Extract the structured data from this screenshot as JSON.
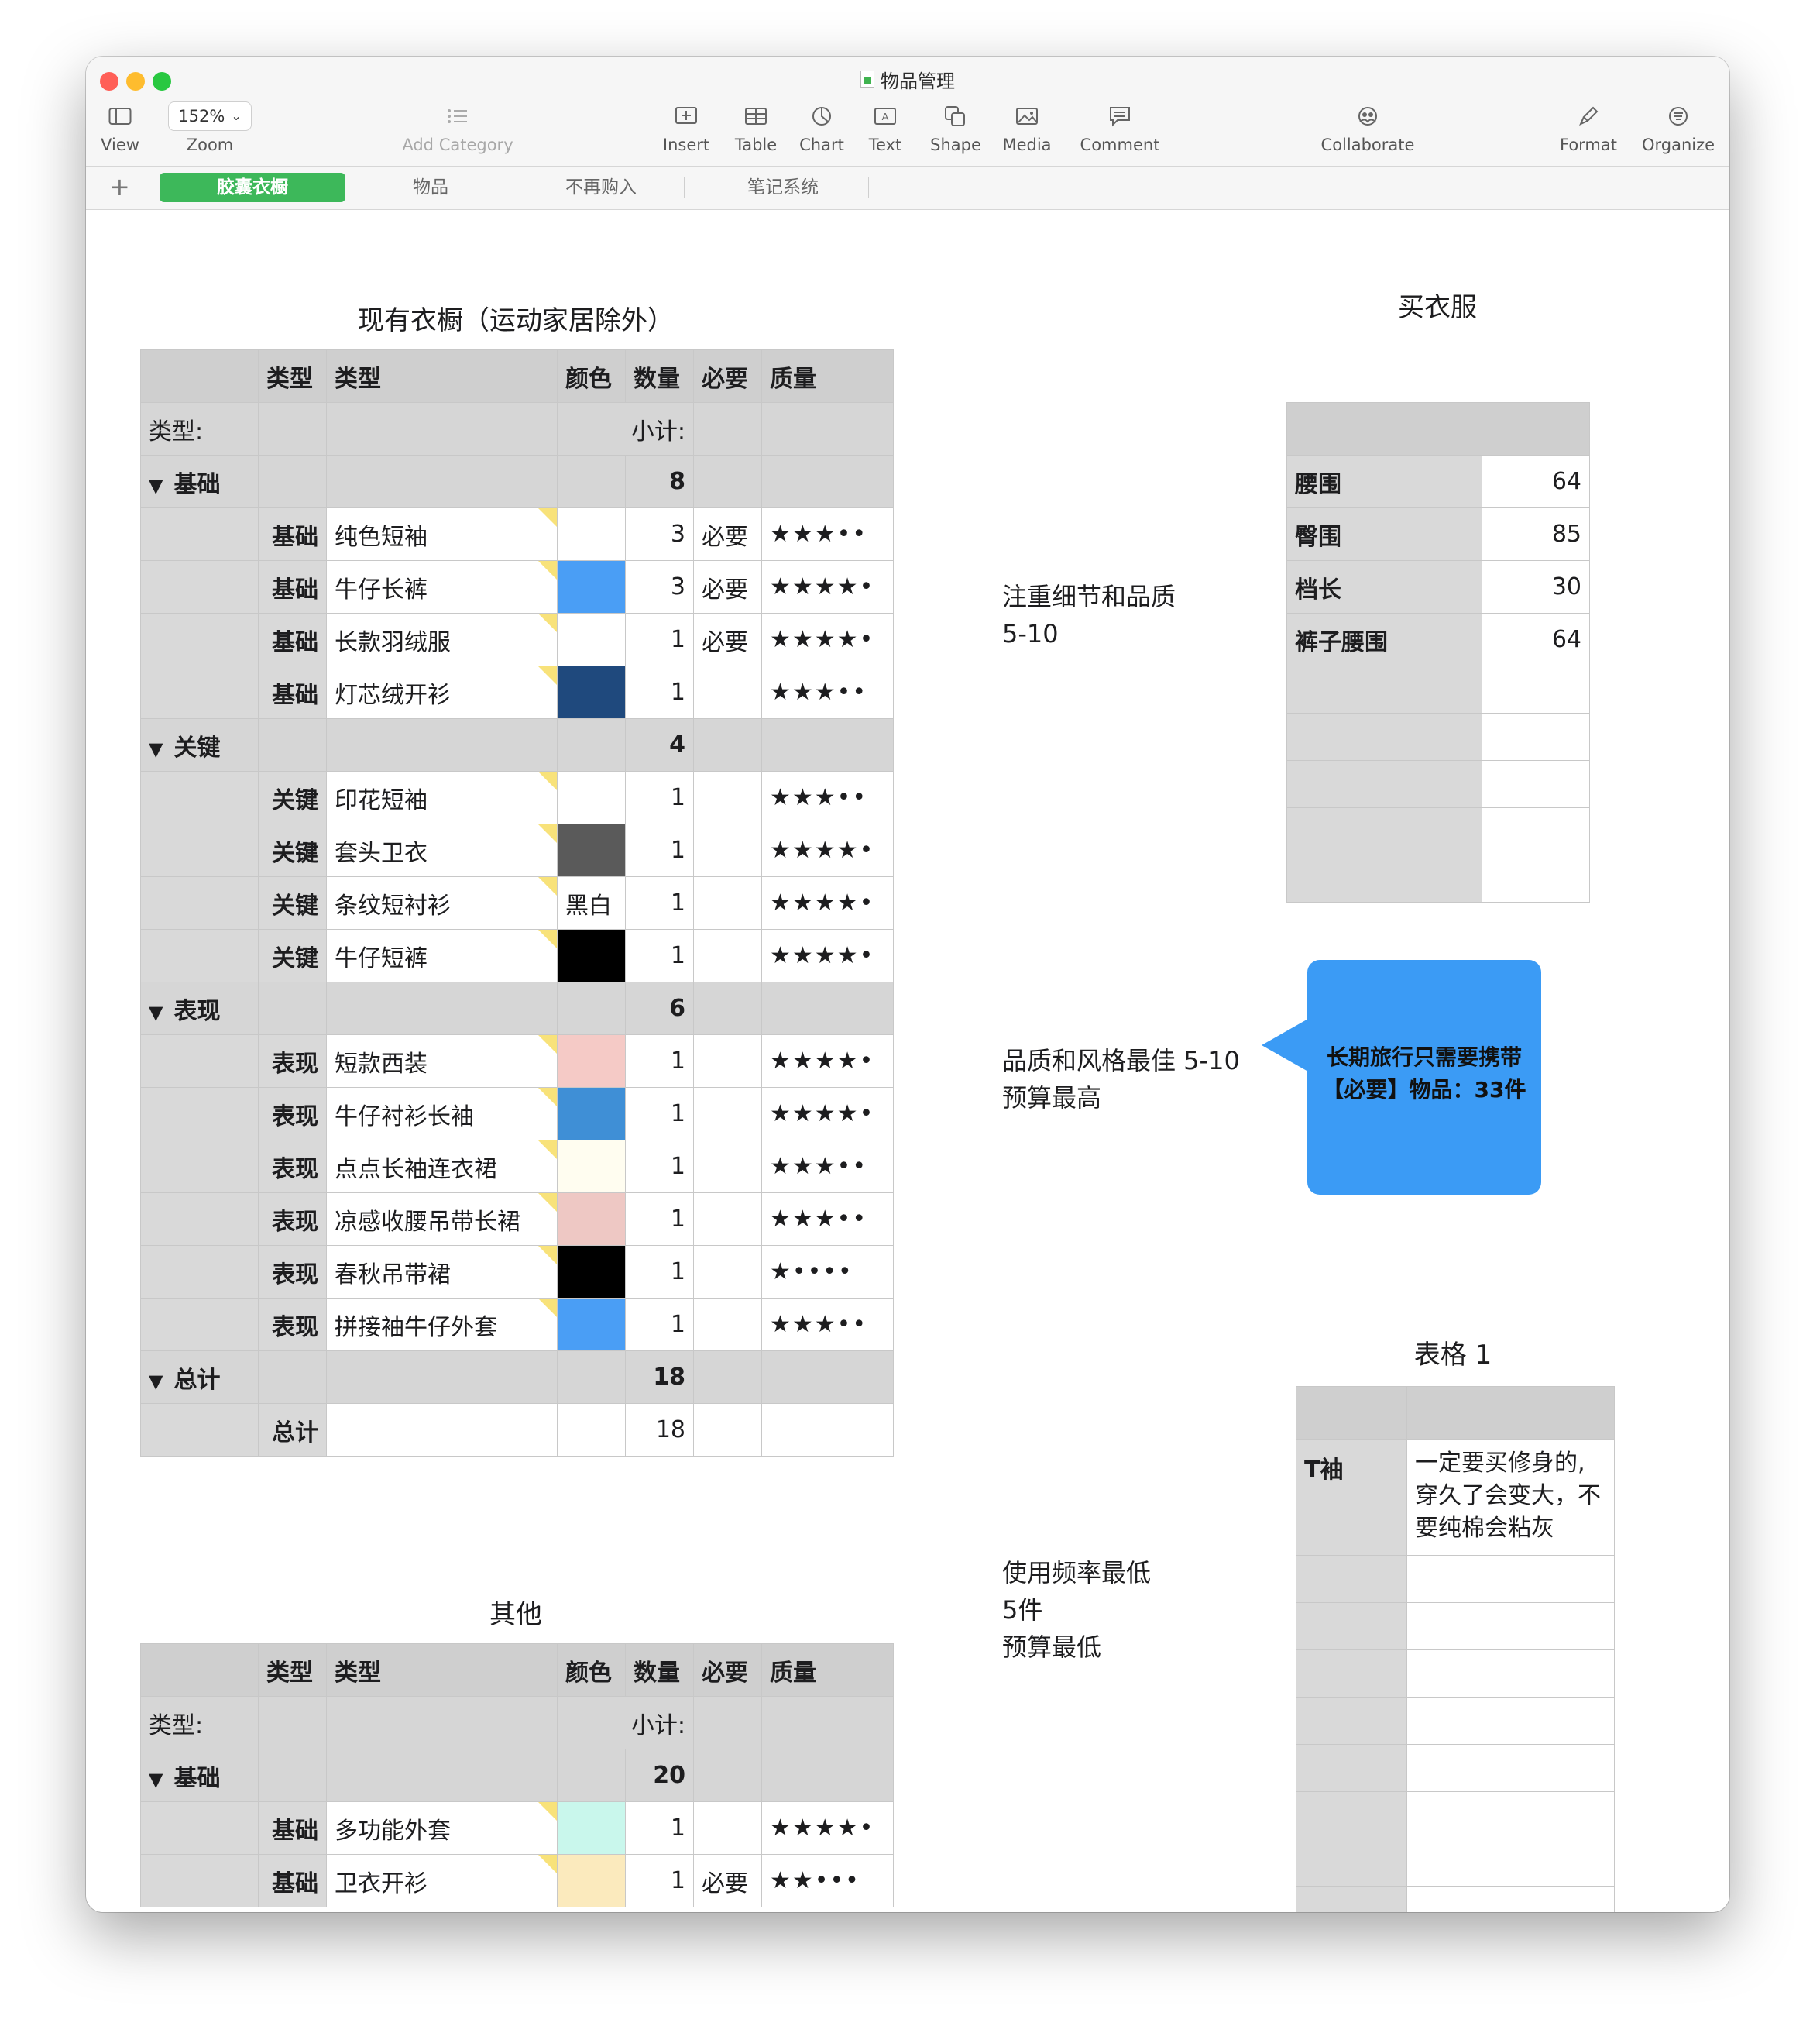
{
  "window": {
    "title": "物品管理"
  },
  "toolbar": {
    "view": "View",
    "zoom_value": "152%",
    "zoom": "Zoom",
    "add_category": "Add Category",
    "insert": "Insert",
    "table": "Table",
    "chart": "Chart",
    "text": "Text",
    "shape": "Shape",
    "media": "Media",
    "comment": "Comment",
    "collaborate": "Collaborate",
    "format": "Format",
    "organize": "Organize"
  },
  "sheets": [
    "胶囊衣橱",
    "物品",
    "不再购入",
    "笔记系统"
  ],
  "wardrobe": {
    "title": "现有衣橱（运动家居除外）",
    "headers": [
      "",
      "类型",
      "类型",
      "颜色",
      "数量",
      "必要",
      "质量"
    ],
    "caption_type": "类型:",
    "caption_subtotal": "小计:",
    "groups": [
      {
        "label": "基础",
        "subtotal": "8",
        "rows": [
          {
            "type": "基础",
            "name": "纯色短袖",
            "color": "#ffffff",
            "color_text": "",
            "qty": "3",
            "need": "必要",
            "stars": "★★★••"
          },
          {
            "type": "基础",
            "name": "牛仔长裤",
            "color": "#4a9ef5",
            "color_text": "",
            "qty": "3",
            "need": "必要",
            "stars": "★★★★•"
          },
          {
            "type": "基础",
            "name": "长款羽绒服",
            "color": "#ffffff",
            "color_text": "",
            "qty": "1",
            "need": "必要",
            "stars": "★★★★•"
          },
          {
            "type": "基础",
            "name": "灯芯绒开衫",
            "color": "#1f497d",
            "color_text": "",
            "qty": "1",
            "need": "",
            "stars": "★★★••"
          }
        ]
      },
      {
        "label": "关键",
        "subtotal": "4",
        "rows": [
          {
            "type": "关键",
            "name": "印花短袖",
            "color": "#ffffff",
            "color_text": "",
            "qty": "1",
            "need": "",
            "stars": "★★★••"
          },
          {
            "type": "关键",
            "name": "套头卫衣",
            "color": "#5a5a5a",
            "color_text": "",
            "qty": "1",
            "need": "",
            "stars": "★★★★•"
          },
          {
            "type": "关键",
            "name": "条纹短衬衫",
            "color": "#ffffff",
            "color_text": "黑白",
            "qty": "1",
            "need": "",
            "stars": "★★★★•"
          },
          {
            "type": "关键",
            "name": "牛仔短裤",
            "color": "#000000",
            "color_text": "",
            "qty": "1",
            "need": "",
            "stars": "★★★★•"
          }
        ]
      },
      {
        "label": "表现",
        "subtotal": "6",
        "rows": [
          {
            "type": "表现",
            "name": "短款西装",
            "color": "#f5cac6",
            "color_text": "",
            "qty": "1",
            "need": "",
            "stars": "★★★★•"
          },
          {
            "type": "表现",
            "name": "牛仔衬衫长袖",
            "color": "#3f8fd6",
            "color_text": "",
            "qty": "1",
            "need": "",
            "stars": "★★★★•"
          },
          {
            "type": "表现",
            "name": "点点长袖连衣裙",
            "color": "#fffdf0",
            "color_text": "",
            "qty": "1",
            "need": "",
            "stars": "★★★••"
          },
          {
            "type": "表现",
            "name": "凉感收腰吊带长裙",
            "color": "#eec8c4",
            "color_text": "",
            "qty": "1",
            "need": "",
            "stars": "★★★••"
          },
          {
            "type": "表现",
            "name": "春秋吊带裙",
            "color": "#000000",
            "color_text": "",
            "qty": "1",
            "need": "",
            "stars": "★••••"
          },
          {
            "type": "表现",
            "name": "拼接袖牛仔外套",
            "color": "#4a9ef5",
            "color_text": "",
            "qty": "1",
            "need": "",
            "stars": "★★★••"
          }
        ]
      }
    ],
    "total_label": "总计",
    "total_value": "18",
    "total_row_label": "总计",
    "total_row_value": "18"
  },
  "others": {
    "title": "其他",
    "headers": [
      "",
      "类型",
      "类型",
      "颜色",
      "数量",
      "必要",
      "质量"
    ],
    "caption_type": "类型:",
    "caption_subtotal": "小计:",
    "group_label": "基础",
    "group_subtotal": "20",
    "rows": [
      {
        "type": "基础",
        "name": "多功能外套",
        "color": "#c9f7ec",
        "qty": "1",
        "need": "",
        "stars": "★★★★•"
      },
      {
        "type": "基础",
        "name": "卫衣开衫",
        "color": "#fbeabd",
        "qty": "1",
        "need": "必要",
        "stars": "★★•••"
      }
    ]
  },
  "notes": {
    "basic_line1": "注重细节和品质",
    "basic_line2": "5-10",
    "perf_line1": "品质和风格最佳 5-10",
    "perf_line2": "预算最高",
    "other_line1": "使用频率最低",
    "other_line2": "5件",
    "other_line3": "预算最低"
  },
  "callout": {
    "line1": "长期旅行只需要携带",
    "line2": "【必要】物品：33件"
  },
  "buy_clothes": {
    "title": "买衣服",
    "rows": [
      {
        "label": "腰围",
        "value": "64"
      },
      {
        "label": "臀围",
        "value": "85"
      },
      {
        "label": "档长",
        "value": "30"
      },
      {
        "label": "裤子腰围",
        "value": "64"
      }
    ]
  },
  "table1": {
    "title": "表格 1",
    "label": "T袖",
    "line1": "一定要买修身的,",
    "line2": "穿久了会变大，不",
    "line3": "要纯棉会粘灰"
  }
}
